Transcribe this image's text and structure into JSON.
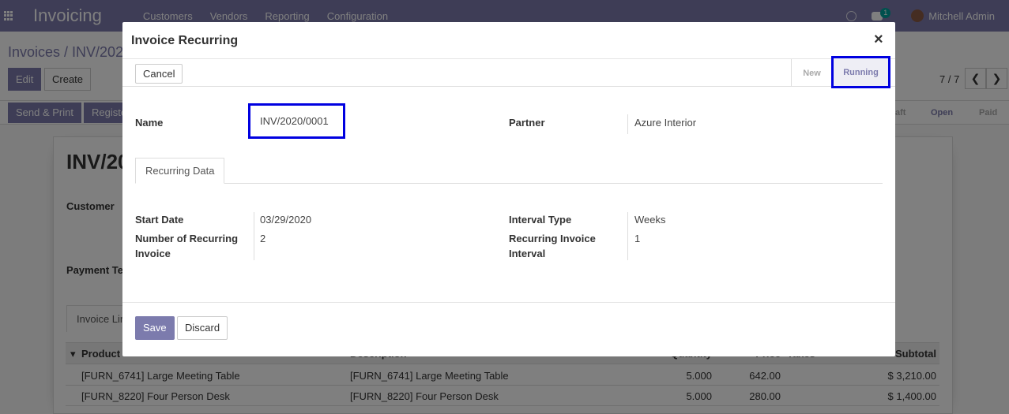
{
  "navbar": {
    "brand": "Invoicing",
    "menu": [
      "Customers",
      "Vendors",
      "Reporting",
      "Configuration"
    ],
    "chat_count": "1",
    "user": "Mitchell Admin"
  },
  "control_panel": {
    "breadcrumb": "Invoices / INV/202",
    "edit_label": "Edit",
    "create_label": "Create",
    "pager": "7 / 7",
    "send_print_label": "Send & Print",
    "register_label": "Registe",
    "status_steps": [
      "aft",
      "Open",
      "Paid"
    ]
  },
  "sheet": {
    "title": "INV/20",
    "customer_label": "Customer",
    "payment_terms_label": "Payment Te",
    "tab_label": "Invoice Lin",
    "columns": [
      "Product",
      "Description",
      "Quantity",
      "Price",
      "Taxes",
      "Subtotal"
    ],
    "rows": [
      {
        "product": "[FURN_6741] Large Meeting Table",
        "description": "[FURN_6741] Large Meeting Table",
        "quantity": "5.000",
        "price": "642.00",
        "subtotal": "$ 3,210.00"
      },
      {
        "product": "[FURN_8220] Four Person Desk",
        "description": "[FURN_8220] Four Person Desk",
        "quantity": "5.000",
        "price": "280.00",
        "subtotal": "$ 1,400.00"
      }
    ]
  },
  "modal": {
    "title": "Invoice Recurring",
    "close_symbol": "×",
    "cancel_label": "Cancel",
    "states": {
      "new": "New",
      "running": "Running"
    },
    "name_label": "Name",
    "name_value": "INV/2020/0001",
    "partner_label": "Partner",
    "partner_value": "Azure Interior",
    "tab_label": "Recurring Data",
    "start_date_label": "Start Date",
    "start_date_value": "03/29/2020",
    "num_recurring_label_1": "Number of Recurring",
    "num_recurring_label_2": "Invoice",
    "num_recurring_value": "2",
    "interval_type_label": "Interval Type",
    "interval_type_value": "Weeks",
    "rec_interval_label_1": "Recurring Invoice",
    "rec_interval_label_2": "Interval",
    "rec_interval_value": "1",
    "save_label": "Save",
    "discard_label": "Discard"
  }
}
